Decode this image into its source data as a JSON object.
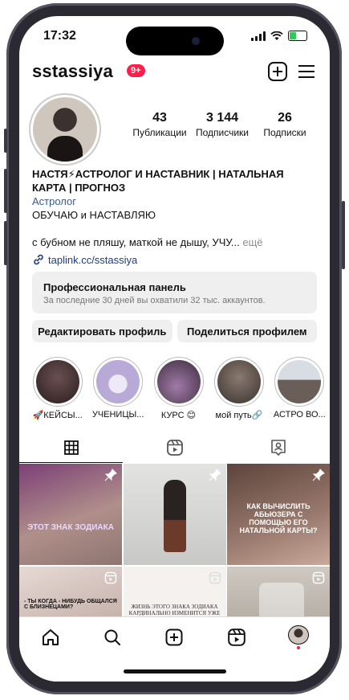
{
  "status": {
    "time": "17:32"
  },
  "header": {
    "username": "sstassiya",
    "notif_badge": "9+"
  },
  "stats": [
    {
      "num": "43",
      "label": "Публикации"
    },
    {
      "num": "3 144",
      "label": "Подписчики"
    },
    {
      "num": "26",
      "label": "Подписки"
    }
  ],
  "bio": {
    "name": "НАСТЯ⚡АСТРОЛОГ И НАСТАВНИК | НАТАЛЬНАЯ КАРТА | ПРОГНОЗ",
    "category": "Астролог",
    "line1": "ОБУЧАЮ и НАСТАВЛЯЮ",
    "line2": "с бубном не пляшу, маткой не дышу, УЧУ...",
    "more": " ещё",
    "link": "taplink.cc/sstassiya"
  },
  "panel": {
    "title": "Профессиональная панель",
    "subtitle": "За последние 30 дней вы охватили 32 тыс. аккаунтов."
  },
  "buttons": {
    "edit": "Редактировать профиль",
    "share": "Поделиться профилем"
  },
  "highlights": [
    {
      "label": "🚀КЕЙСЫ...",
      "color": "#3a2a30"
    },
    {
      "label": "УЧЕНИЦЫ...",
      "color": "#b9a9d6"
    },
    {
      "label": "КУРС 😊",
      "color": "#4a3340"
    },
    {
      "label": "мой путь🔗",
      "color": "#5a4e48"
    },
    {
      "label": "АСТРО ВО...",
      "color": "#9aa6b8"
    }
  ],
  "grid": [
    {
      "text": "ЭТОТ ЗНАК ЗОДИАКА",
      "bg": "#a48a86",
      "icon": "pin-icon"
    },
    {
      "text": "",
      "bg": "#d9d9d7",
      "icon": "pin-icon"
    },
    {
      "text": "КАК ВЫЧИСЛИТЬ АБЬЮЗЕРА С ПОМОЩЬЮ ЕГО НАТАЛЬНОЙ КАРТЫ?",
      "bg": "#7c5f56",
      "icon": "pin-icon"
    },
    {
      "text": "- ТЫ КОГДА - НИБУДЬ ОБЩАЛСЯ С БЛИЗНЕЦАМИ?",
      "bg": "#cbb9b3",
      "icon": "reels-icon"
    },
    {
      "text": "ЖИЗНЬ ЭТОГО ЗНАКА ЗОДИАКА КАРДИНАЛЬНО ИЗМЕНИТСЯ УЖЕ В БЛИЖАЙШЕЕ ВРЕМЯ",
      "bg": "#f4f1ee",
      "icon": "reels-icon"
    },
    {
      "text": "",
      "bg": "#b9b3ab",
      "icon": "reels-icon"
    }
  ]
}
